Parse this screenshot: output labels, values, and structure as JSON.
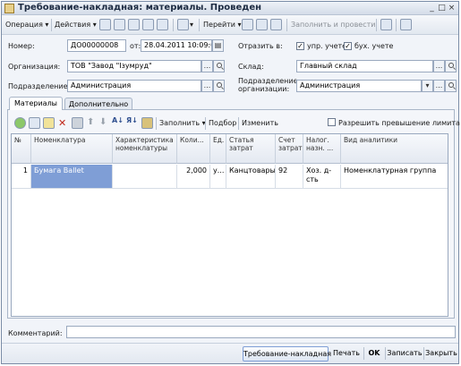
{
  "window": {
    "title": "Требование-накладная: материалы. Проведен"
  },
  "toolbar": {
    "operation": "Операция",
    "actions": "Действия",
    "goto": "Перейти",
    "fill_and_post": "Заполнить и провести"
  },
  "header": {
    "number_label": "Номер:",
    "number": "ДО00000008",
    "from_label": "от:",
    "date": "28.04.2011 10:09:00",
    "reflect_label": "Отразить в:",
    "mgmt_label": "упр. учете",
    "acct_label": "бух. учете",
    "org_label": "Организация:",
    "org": "ТОВ \"Завод \"Ізумруд\"",
    "warehouse_label": "Склад:",
    "warehouse": "Главный склад",
    "dept_label": "Подразделение:",
    "dept": "Администрация",
    "org_dept_label1": "Подразделение",
    "org_dept_label2": "организации:",
    "org_dept": "Администрация"
  },
  "tabs": [
    {
      "label": "Материалы"
    },
    {
      "label": "Дополнительно"
    }
  ],
  "tabletoolbar": {
    "fill": "Заполнить",
    "selection": "Подбор",
    "change": "Изменить",
    "allow_excess": "Разрешить превышение лимита"
  },
  "table": {
    "headers": {
      "num": "№",
      "item": "Номенклатура",
      "char": "Характеристика номенклатуры",
      "qty": "Коли...",
      "unit": "Ед.",
      "cost_type": "Статья затрат",
      "cost_acc": "Счет затрат",
      "tax_purpose": "Налог. назн. ...",
      "analytics": "Вид аналитики"
    },
    "rows": [
      {
        "num": "1",
        "item": "Бумага Ballet",
        "char": "",
        "qty": "2,000",
        "unit": "у...",
        "cost_type": "Канцтовары",
        "cost_acc": "92",
        "tax_purpose": "Хоз. д-сть",
        "analytics": "Номенклатурная группа"
      }
    ]
  },
  "comment": {
    "label": "Комментарий:",
    "value": ""
  },
  "bottom": {
    "req_invoice": "Требование-накладная",
    "print": "Печать",
    "ok": "OK",
    "save": "Записать",
    "close": "Закрыть"
  },
  "colors": {
    "selection": "#7f9ed6",
    "accent": "#1d2b42"
  }
}
